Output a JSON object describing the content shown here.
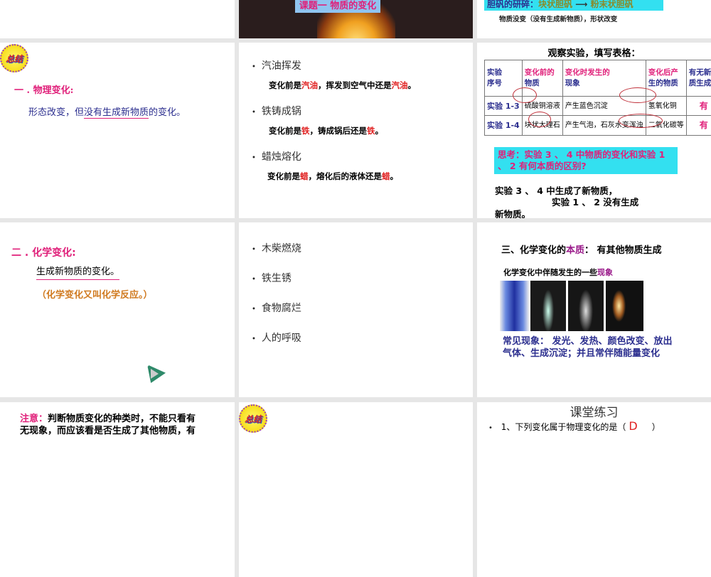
{
  "slides": {
    "s_top_mid": {
      "title": "课题一  物质的变化"
    },
    "s_top_right": {
      "box_a": "胆矾的研碎：",
      "box_b": "块状胆矾",
      "arrow": "⟶",
      "box_c": "粉末状胆矾",
      "line": "物质没变（没有生成新物质），形状改变"
    },
    "s_phys": {
      "badge": "总结",
      "heading": "一 . 物理变化:",
      "def_a": "形态改变，但",
      "def_b": "没有生成新物质",
      "def_c": "的变化。"
    },
    "s_examples1": {
      "items": [
        {
          "title": "汽油挥发",
          "a": "变化前是",
          "b": "汽油",
          "c": "，挥发到空气中还是",
          "d": "汽油",
          "e": "。"
        },
        {
          "title": "铁铸成锅",
          "a": "变化前是",
          "b": "铁",
          "c": "，铸成锅后还是",
          "d": "铁",
          "e": "。"
        },
        {
          "title": "蜡烛熔化",
          "a": "变化前是",
          "b": "蜡",
          "c": "，熔化后的液体还是",
          "d": "蜡",
          "e": "。"
        }
      ]
    },
    "s_table": {
      "title": "观察实验，填写表格：",
      "headers": [
        [
          "实验",
          "序号"
        ],
        [
          "变化前的",
          "物质"
        ],
        [
          "变化时发生的",
          "现象"
        ],
        [
          "变化后产",
          "生的物质"
        ],
        [
          "有无新物",
          "质生成"
        ]
      ],
      "rows": [
        [
          "实验 1-3",
          "硫酸铜溶液",
          "产生蓝色沉淀",
          "氢氧化铜",
          "有"
        ],
        [
          "实验 1-4",
          "块状大理石",
          "产生气泡，石灰水变浑浊",
          "二氧化碳等",
          "有"
        ]
      ],
      "think": "思考：实验 3 、 4 中物质的变化和实验 1 、 2 有何本质的区别?",
      "ans1": "实验 3 、 4 中生成了新物质，",
      "ans2": "实验 1 、 2 没有生成",
      "ans3": "新物质。"
    },
    "s_chem": {
      "heading": "二 . 化学变化:",
      "def": "生成新物质的变化。",
      "note": "（化学变化又叫化学反应。）"
    },
    "s_examples2": {
      "items": [
        "木柴燃烧",
        "铁生锈",
        "食物腐烂",
        "人的呼吸"
      ]
    },
    "s_essence": {
      "t_a": "三、化学变化的",
      "t_b": "本质",
      "t_c": "：  有其他物质生成",
      "sub_a": "化学变化中伴随发生的一些",
      "sub_b": "现象",
      "common": "常见现象：  发光、发热、颜色改变、放出气体、生成沉淀；并且常伴随能量变化"
    },
    "s_note": {
      "label": "注意：",
      "text": "判断物质变化的种类时，不能只看有",
      "line2": "无现象，而应该看是否生成了其他物质，有"
    },
    "s_badge2": {
      "badge": "总结"
    },
    "s_practice": {
      "title": "课堂练习",
      "q1": "1、下列变化属于物理变化的是（",
      "ans": "D",
      "close": "）"
    }
  },
  "colors": {
    "pink": "#e0207a",
    "navy": "#2c2f8f",
    "red": "#e02020",
    "cyan": "#33e0f0",
    "orange": "#d07a20"
  }
}
